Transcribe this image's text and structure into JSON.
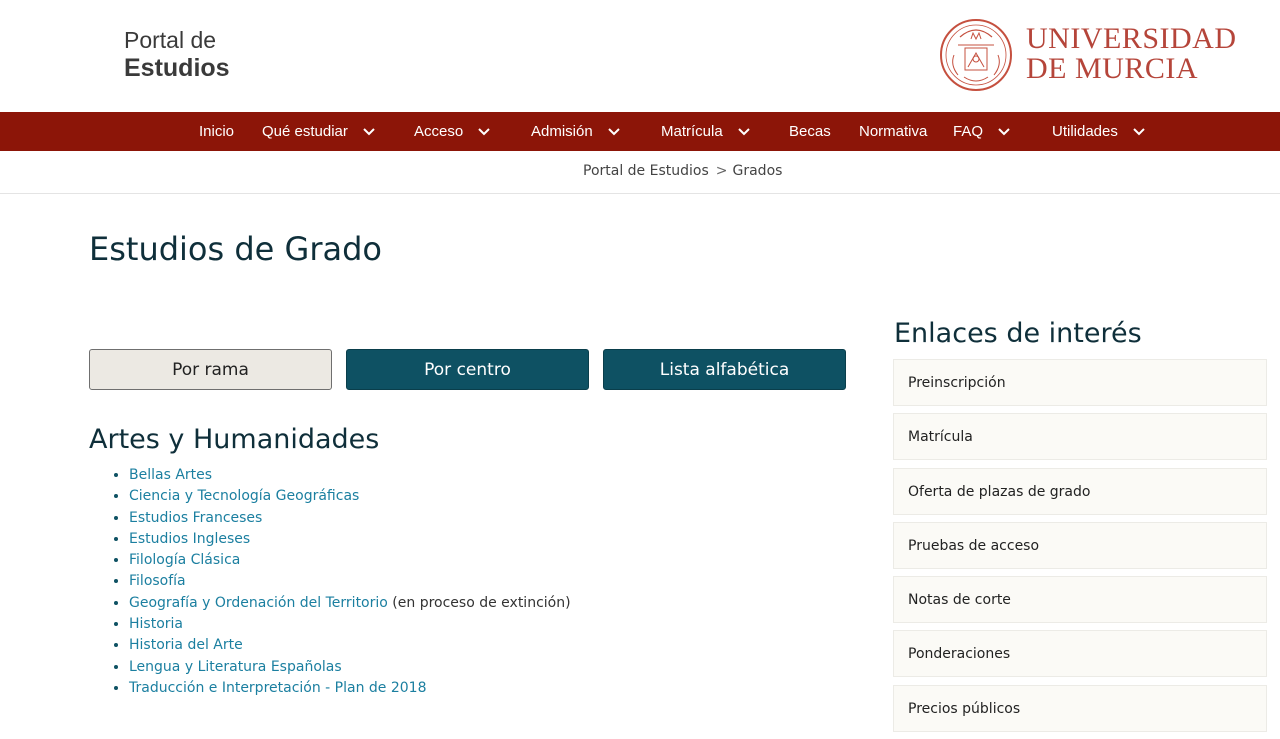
{
  "header": {
    "portal_line1": "Portal de",
    "portal_line2": "Estudios",
    "university_line1": "UNIVERSIDAD",
    "university_line2": "DE MURCIA"
  },
  "nav": {
    "items": [
      {
        "label": "Inicio"
      },
      {
        "label": "Qué estudiar"
      },
      {
        "label": "Acceso"
      },
      {
        "label": "Admisión"
      },
      {
        "label": "Matrícula"
      },
      {
        "label": "Becas"
      },
      {
        "label": "Normativa"
      },
      {
        "label": "FAQ"
      },
      {
        "label": "Utilidades"
      }
    ]
  },
  "breadcrumb": {
    "items": [
      "Portal de Estudios",
      "Grados"
    ],
    "separator": ">"
  },
  "page": {
    "title": "Estudios de Grado"
  },
  "tabs": [
    {
      "label": "Por rama",
      "active": true
    },
    {
      "label": "Por centro",
      "active": false
    },
    {
      "label": "Lista alfabética",
      "active": false
    }
  ],
  "section": {
    "title": "Artes y Humanidades",
    "degrees": [
      {
        "label": "Bellas Artes",
        "note": ""
      },
      {
        "label": "Ciencia y Tecnología Geográficas",
        "note": ""
      },
      {
        "label": "Estudios Franceses",
        "note": ""
      },
      {
        "label": "Estudios Ingleses",
        "note": ""
      },
      {
        "label": "Filología Clásica",
        "note": ""
      },
      {
        "label": "Filosofía",
        "note": ""
      },
      {
        "label": "Geografía y Ordenación del Territorio",
        "note": "(en proceso de extinción)"
      },
      {
        "label": "Historia",
        "note": ""
      },
      {
        "label": "Historia del Arte",
        "note": ""
      },
      {
        "label": "Lengua y Literatura Españolas",
        "note": ""
      },
      {
        "label": "Traducción e Interpretación - Plan de 2018",
        "note": ""
      }
    ]
  },
  "sidebar": {
    "title": "Enlaces de interés",
    "links": [
      {
        "label": "Preinscripción"
      },
      {
        "label": "Matrícula"
      },
      {
        "label": "Oferta de plazas de grado"
      },
      {
        "label": "Pruebas de acceso"
      },
      {
        "label": "Notas de corte"
      },
      {
        "label": "Ponderaciones"
      },
      {
        "label": "Precios públicos"
      }
    ]
  },
  "colors": {
    "nav_bg": "#8c1508",
    "tab_active_bg": "#ece9e3",
    "tab_inactive_bg": "#0e5163",
    "link": "#1b7fa0",
    "heading": "#0f2f3a",
    "brand_red": "#b5453a"
  },
  "icons": {
    "dropdown": "chevron-down-icon",
    "breadcrumb_sep": "chevron-right-icon",
    "university_logo": "university-seal-icon"
  }
}
